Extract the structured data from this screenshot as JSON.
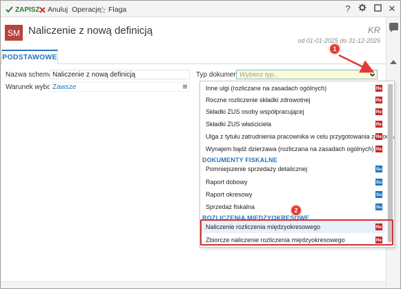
{
  "toolbar": {
    "save_label": "ZAPISZ",
    "cancel_label": "Anuluj",
    "operations_label": "Operacje",
    "flag_label": "Flaga",
    "help_label": "?",
    "settings_icon": "gear-icon",
    "maximize_icon": "maximize-icon",
    "close_label": "✕"
  },
  "header": {
    "badge": "SM",
    "title": "Naliczenie z nową definicją",
    "kr": "KR",
    "period": "od 01-01-2025 do 31-12-2025"
  },
  "tabs": [
    {
      "label": "PODSTAWOWE",
      "active": true
    }
  ],
  "form": {
    "nazwa_label": "Nazwa schematu:",
    "nazwa_value": "Naliczenie z nową definicją",
    "warunek_label": "Warunek wyboru:",
    "warunek_value": "Zawsze",
    "typ_label": "Typ dokumentu:",
    "typ_placeholder": "Wybierz typ..."
  },
  "dropdown": {
    "items_top": [
      {
        "label": "Inne ulgi (rozliczane na zasadach ogólnych)",
        "tag": "Re"
      },
      {
        "label": "Roczne rozliczenie składki zdrowotnej",
        "tag": "Re"
      },
      {
        "label": "Składki ZUS osoby współpracującej",
        "tag": "Re"
      },
      {
        "label": "Składki ZUS właściciela",
        "tag": "Re"
      },
      {
        "label": "Ulga z tytułu zatrudnienia pracownika w celu przygotowania zawodowego",
        "tag": "Re"
      },
      {
        "label": "Wynajem bądź dzierżawa (rozliczana na zasadach ogólnych)",
        "tag": "Re"
      }
    ],
    "group_fiskalne": "DOKUMENTY FISKALNE",
    "items_fiskalne": [
      {
        "label": "Pomniejszenie sprzedaży detalicznej",
        "tag": "Su"
      },
      {
        "label": "Raport dobowy",
        "tag": "Su"
      },
      {
        "label": "Raport okresowy",
        "tag": "Su"
      },
      {
        "label": "Sprzedaż fiskalna",
        "tag": "Su"
      }
    ],
    "group_rozliczenia": "ROZLICZENIA MIĘDZYOKRESOWE",
    "items_rozliczenia": [
      {
        "label": "Naliczenie rozliczenia międzyokresowego",
        "tag": "Re"
      },
      {
        "label": "Zbiorcze naliczenie rozliczenia międzyokresowego",
        "tag": "Re"
      }
    ]
  },
  "annotations": {
    "marker1": "1",
    "marker2": "2",
    "color": "#e53935"
  },
  "colors": {
    "accent": "#2a74b8",
    "badge": "#b6443f",
    "tag_re": "#c62828",
    "tag_su": "#1f74c4"
  }
}
